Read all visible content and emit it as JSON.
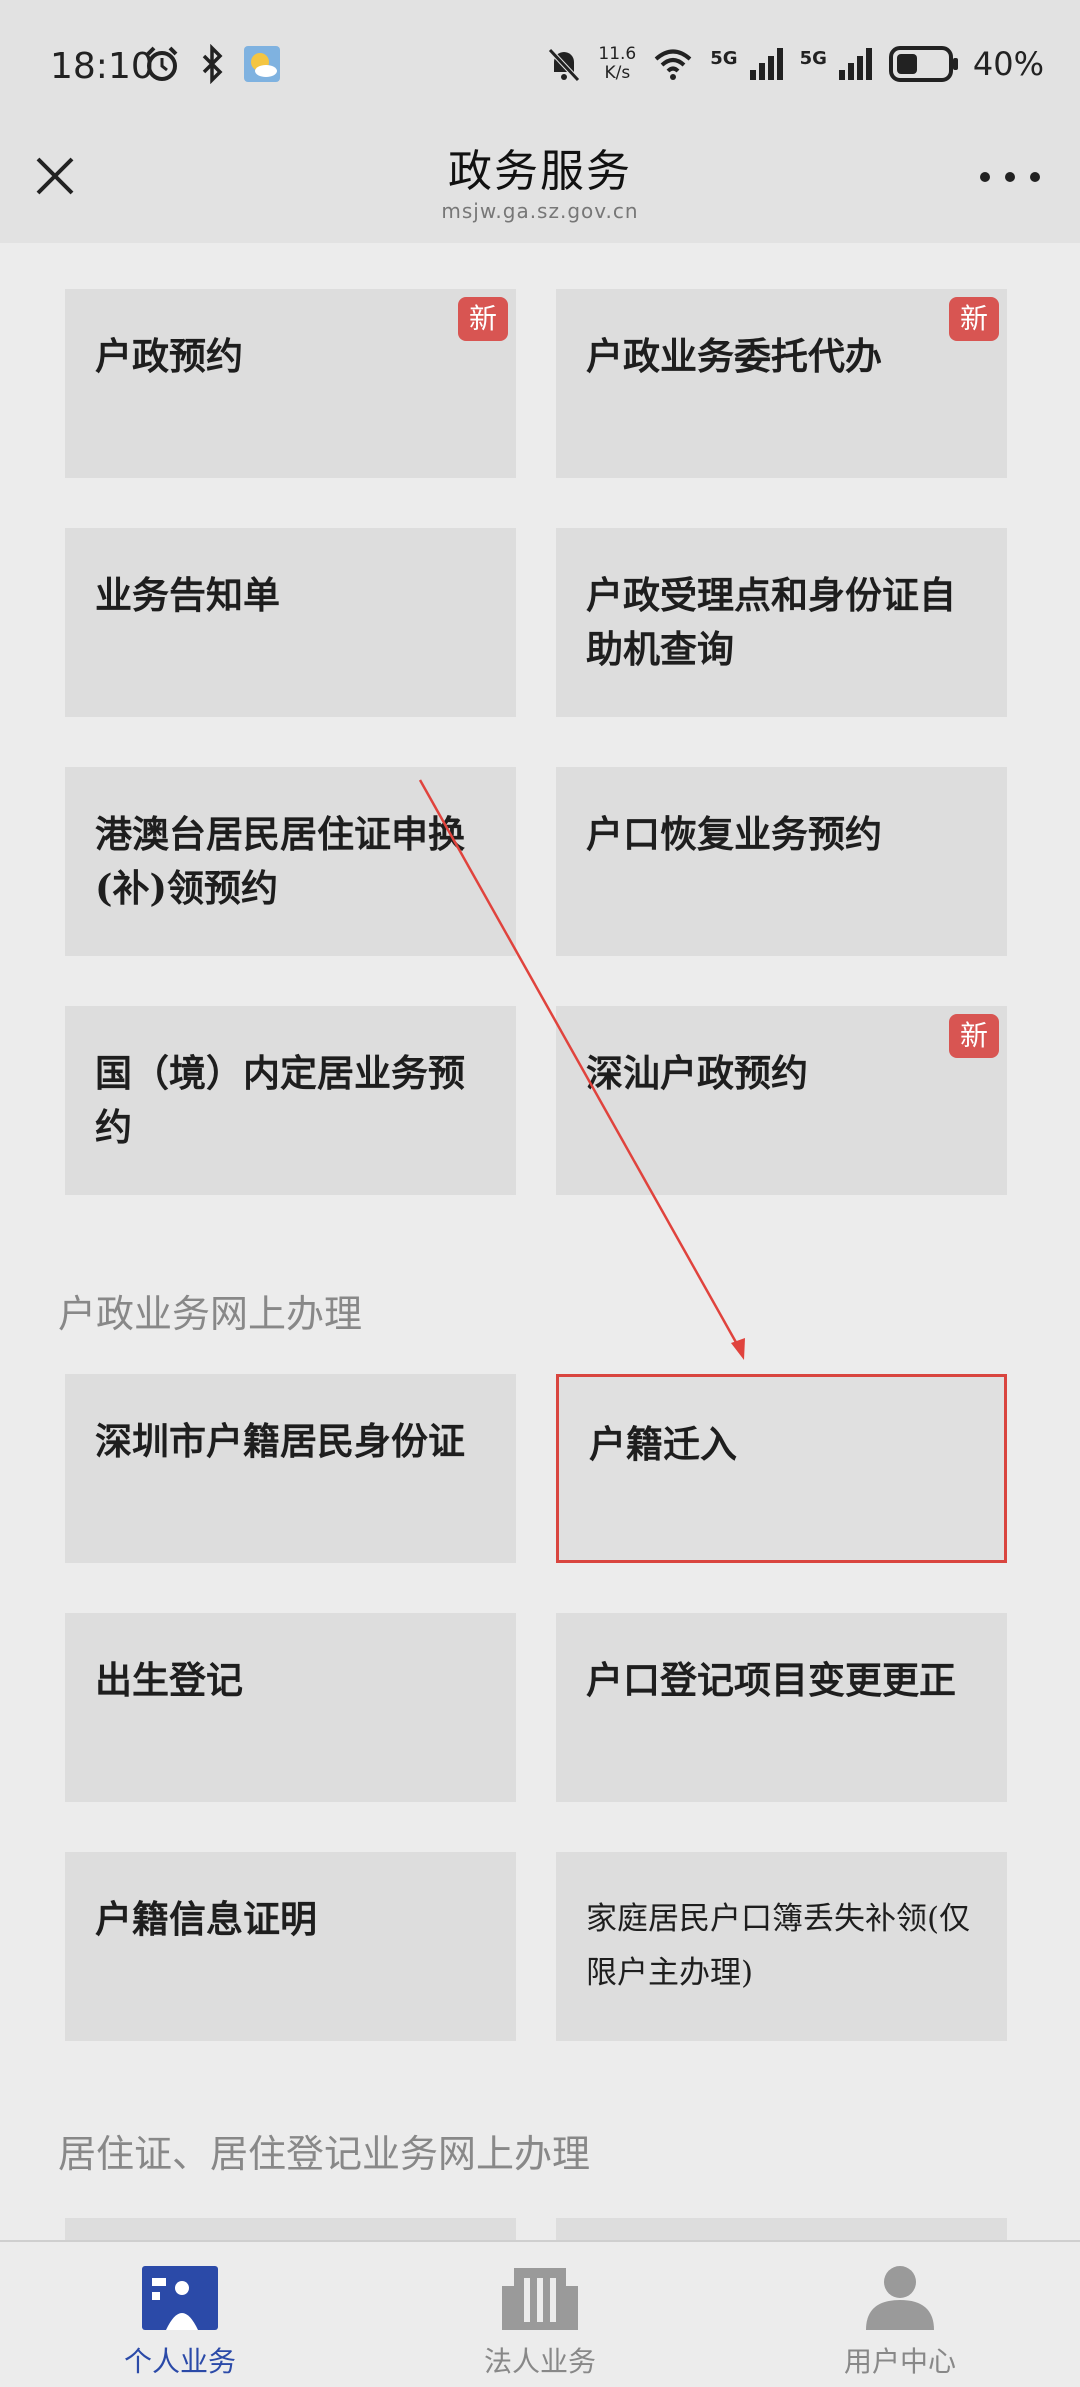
{
  "status_bar": {
    "time": "18:10",
    "net_speed_value": "11.6",
    "net_speed_unit": "K/s",
    "sig1_label": "5G",
    "sig2_label": "5G",
    "battery": "40%"
  },
  "header": {
    "title": "政务服务",
    "url": "msjw.ga.sz.gov.cn"
  },
  "group1": {
    "cards": [
      {
        "label": "户政预约",
        "badge": "新"
      },
      {
        "label": "户政业务委托代办",
        "badge": "新"
      },
      {
        "label": "业务告知单"
      },
      {
        "label": "户政受理点和身份证自助机查询"
      },
      {
        "label": "港澳台居民居住证申换(补)领预约"
      },
      {
        "label": "户口恢复业务预约"
      },
      {
        "label": "国（境）内定居业务预约"
      },
      {
        "label": "深汕户政预约",
        "badge": "新"
      }
    ]
  },
  "section2": {
    "title": "户政业务网上办理",
    "cards": [
      {
        "label": "深圳市户籍居民身份证"
      },
      {
        "label": "户籍迁入"
      },
      {
        "label": "出生登记"
      },
      {
        "label": "户口登记项目变更更正"
      },
      {
        "label": "户籍信息证明"
      },
      {
        "label": "家庭居民户口簿丢失补领(仅限户主办理)"
      }
    ]
  },
  "section3": {
    "title": "居住证、居住登记业务网上办理"
  },
  "bottom_nav": {
    "items": [
      {
        "label": "个人业务",
        "active": true
      },
      {
        "label": "法人业务",
        "active": false
      },
      {
        "label": "用户中心",
        "active": false
      }
    ]
  },
  "colors": {
    "accent_blue": "#2b4aa8",
    "badge_red": "#d85552",
    "highlight_red": "#d9453f"
  }
}
